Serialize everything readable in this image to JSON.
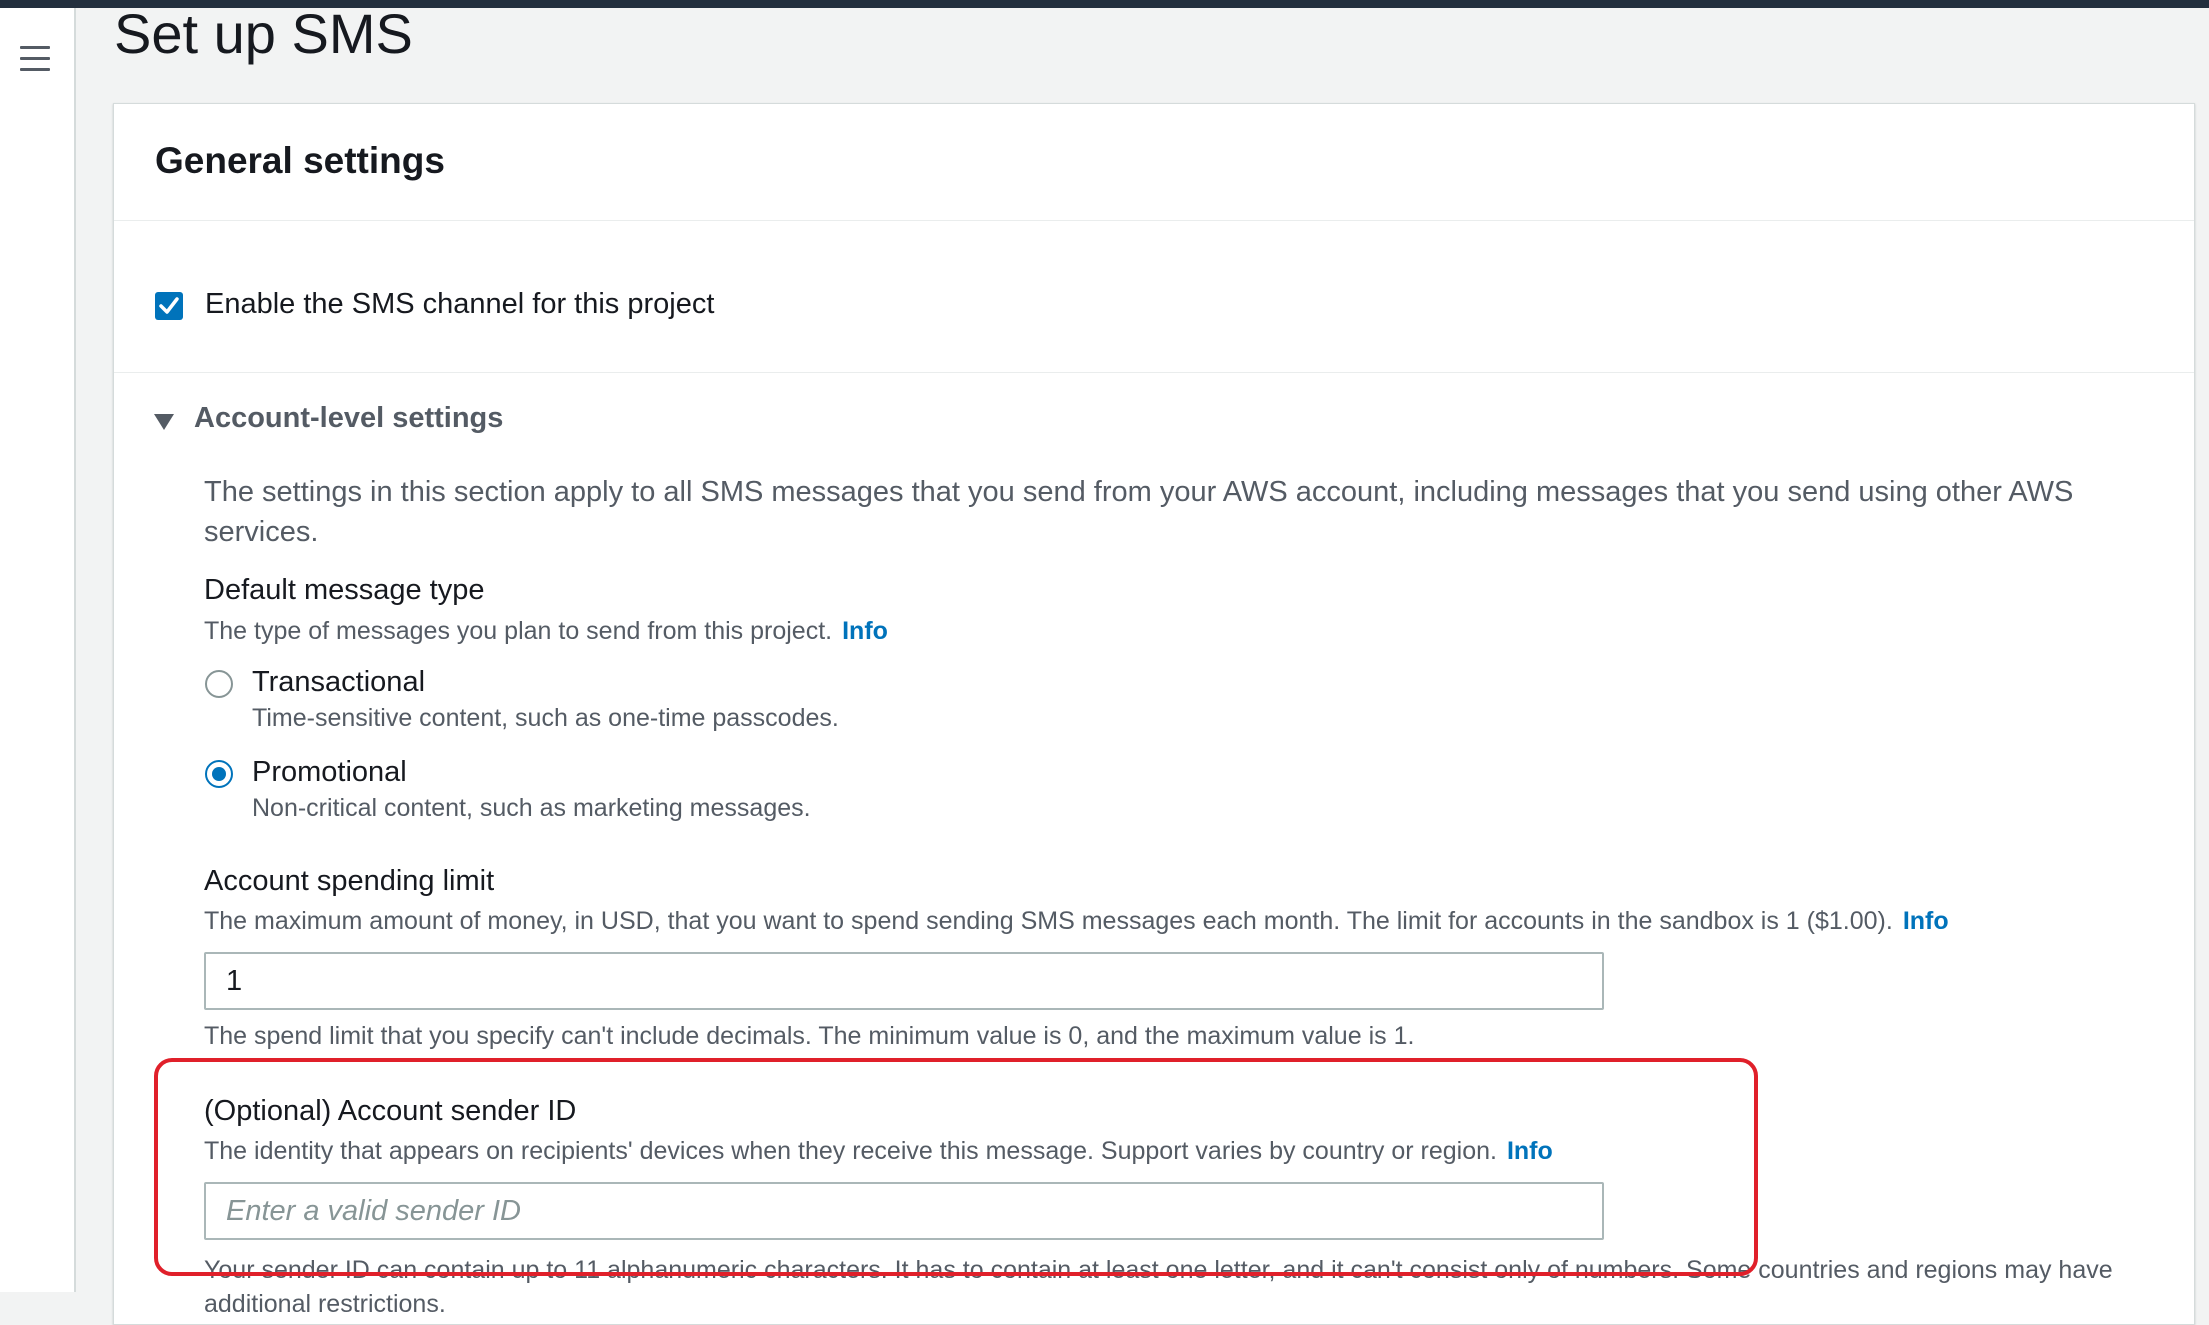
{
  "page": {
    "title": "Set up SMS"
  },
  "panel": {
    "title": "General settings",
    "enable_channel": {
      "label": "Enable the SMS channel for this project",
      "checked": true
    },
    "account_section": {
      "label": "Account-level settings",
      "description": "The settings in this section apply to all SMS messages that you send from your AWS account, including messages that you send using other AWS services."
    },
    "message_type": {
      "label": "Default message type",
      "description": "The type of messages you plan to send from this project.",
      "info": "Info",
      "options": [
        {
          "label": "Transactional",
          "description": "Time-sensitive content, such as one-time passcodes.",
          "selected": false
        },
        {
          "label": "Promotional",
          "description": "Non-critical content, such as marketing messages.",
          "selected": true
        }
      ]
    },
    "spending_limit": {
      "label": "Account spending limit",
      "description": "The maximum amount of money, in USD, that you want to spend sending SMS messages each month. The limit for accounts in the sandbox is 1 ($1.00).",
      "info": "Info",
      "value": "1",
      "constraint": "The spend limit that you specify can't include decimals. The minimum value is 0, and the maximum value is 1."
    },
    "sender_id": {
      "label": "(Optional) Account sender ID",
      "description": "The identity that appears on recipients' devices when they receive this message. Support varies by country or region.",
      "info": "Info",
      "placeholder": "Enter a valid sender ID",
      "constraint": "Your sender ID can contain up to 11 alphanumeric characters. It has to contain at least one letter, and it can't consist only of numbers. Some countries and regions may have additional restrictions."
    }
  },
  "colors": {
    "accent": "#0073bb",
    "highlight": "#e0202a",
    "text_secondary": "#545b64"
  }
}
